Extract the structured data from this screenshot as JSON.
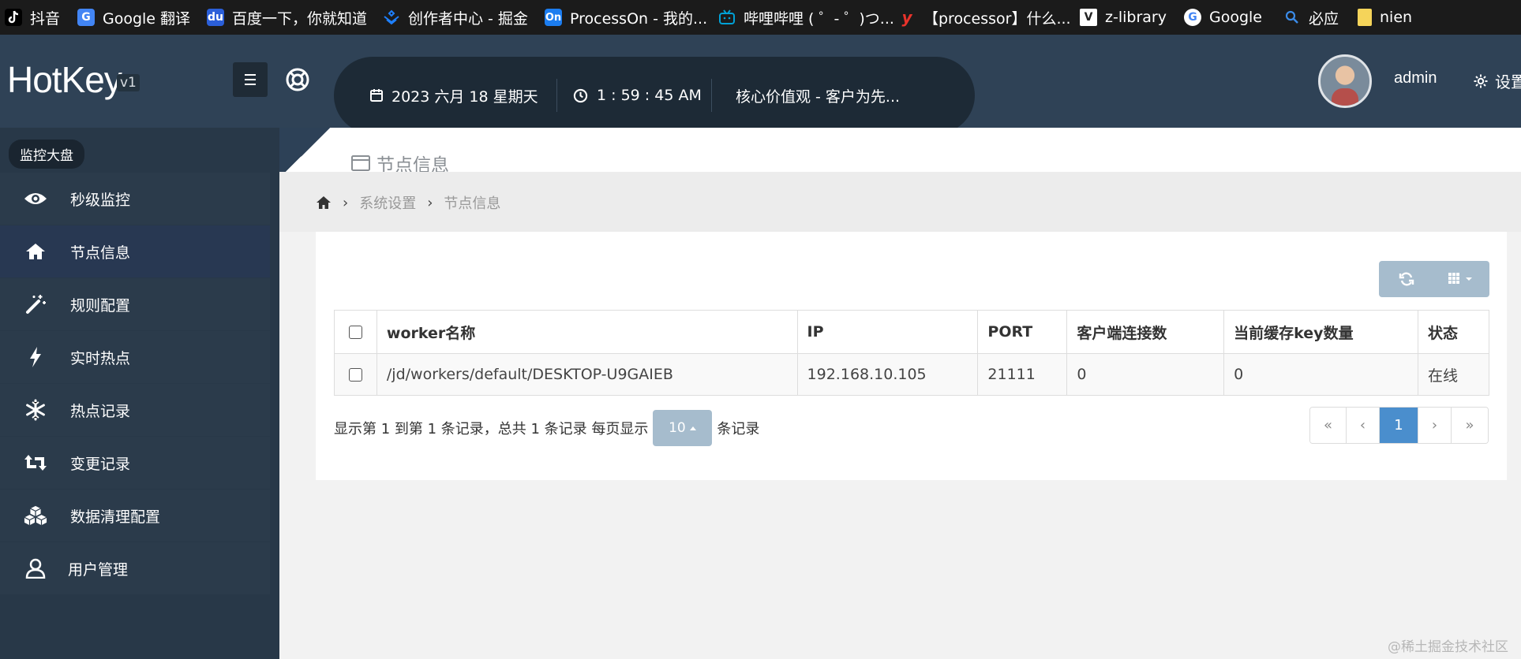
{
  "bookmarks": [
    {
      "label": "抖音",
      "icon": "tiktok-icon"
    },
    {
      "label": "Google 翻译",
      "icon": "google-translate-icon"
    },
    {
      "label": "百度一下，你就知道",
      "icon": "baidu-icon"
    },
    {
      "label": "创作者中心 - 掘金",
      "icon": "juejin-icon"
    },
    {
      "label": "ProcessOn - 我的...",
      "icon": "processon-icon"
    },
    {
      "label": "哔哩哔哩 ( ゜- ゜)つ...",
      "icon": "bilibili-icon"
    },
    {
      "label": "【processor】什么...",
      "icon": "youdao-icon"
    },
    {
      "label": "z-library",
      "icon": "zlibrary-icon"
    },
    {
      "label": "Google",
      "icon": "google-icon"
    },
    {
      "label": "必应",
      "icon": "bing-search-icon"
    },
    {
      "label": "nien",
      "icon": "folder-icon"
    }
  ],
  "header": {
    "logo": "HotKey",
    "version": "v1",
    "date": "2023 六月 18 星期天",
    "time": "1 : 59 : 45 AM",
    "motto": "核心价值观 - 客户为先...",
    "user": "admin",
    "settings": "设置"
  },
  "sidebar": {
    "tag": "监控大盘",
    "items": [
      {
        "label": "秒级监控",
        "icon": "eye-icon",
        "active": false
      },
      {
        "label": "节点信息",
        "icon": "home-icon",
        "active": true
      },
      {
        "label": "规则配置",
        "icon": "magic-wand-icon",
        "active": false
      },
      {
        "label": "实时热点",
        "icon": "lightning-icon",
        "active": false
      },
      {
        "label": "热点记录",
        "icon": "snowflake-icon",
        "active": false
      },
      {
        "label": "变更记录",
        "icon": "retweet-icon",
        "active": false
      },
      {
        "label": "数据清理配置",
        "icon": "cubes-icon",
        "active": false
      },
      {
        "label": "用户管理",
        "icon": "user-icon",
        "active": false
      }
    ]
  },
  "page": {
    "title": "节点信息",
    "breadcrumb": [
      "系统设置",
      "节点信息"
    ]
  },
  "table": {
    "headers": [
      "worker名称",
      "IP",
      "PORT",
      "客户端连接数",
      "当前缓存key数量",
      "状态"
    ],
    "rows": [
      [
        "/jd/workers/default/DESKTOP-U9GAIEB",
        "192.168.10.105",
        "21111",
        "0",
        "0",
        "在线"
      ]
    ]
  },
  "pagination": {
    "info_prefix": "显示第 1 到第 1 条记录，总共 1 条记录 每页显示",
    "page_size": "10",
    "info_suffix": "条记录",
    "first": "«",
    "prev": "‹",
    "current": "1",
    "next": "›",
    "last": "»"
  },
  "watermark": "@稀土掘金技术社区",
  "colors": {
    "header_bg": "#2f4256",
    "sidebar_bg": "#283848",
    "active_item_bg": "#283852",
    "accent_blue": "#4a8ecd",
    "button_gray_blue": "#a6bccd"
  }
}
